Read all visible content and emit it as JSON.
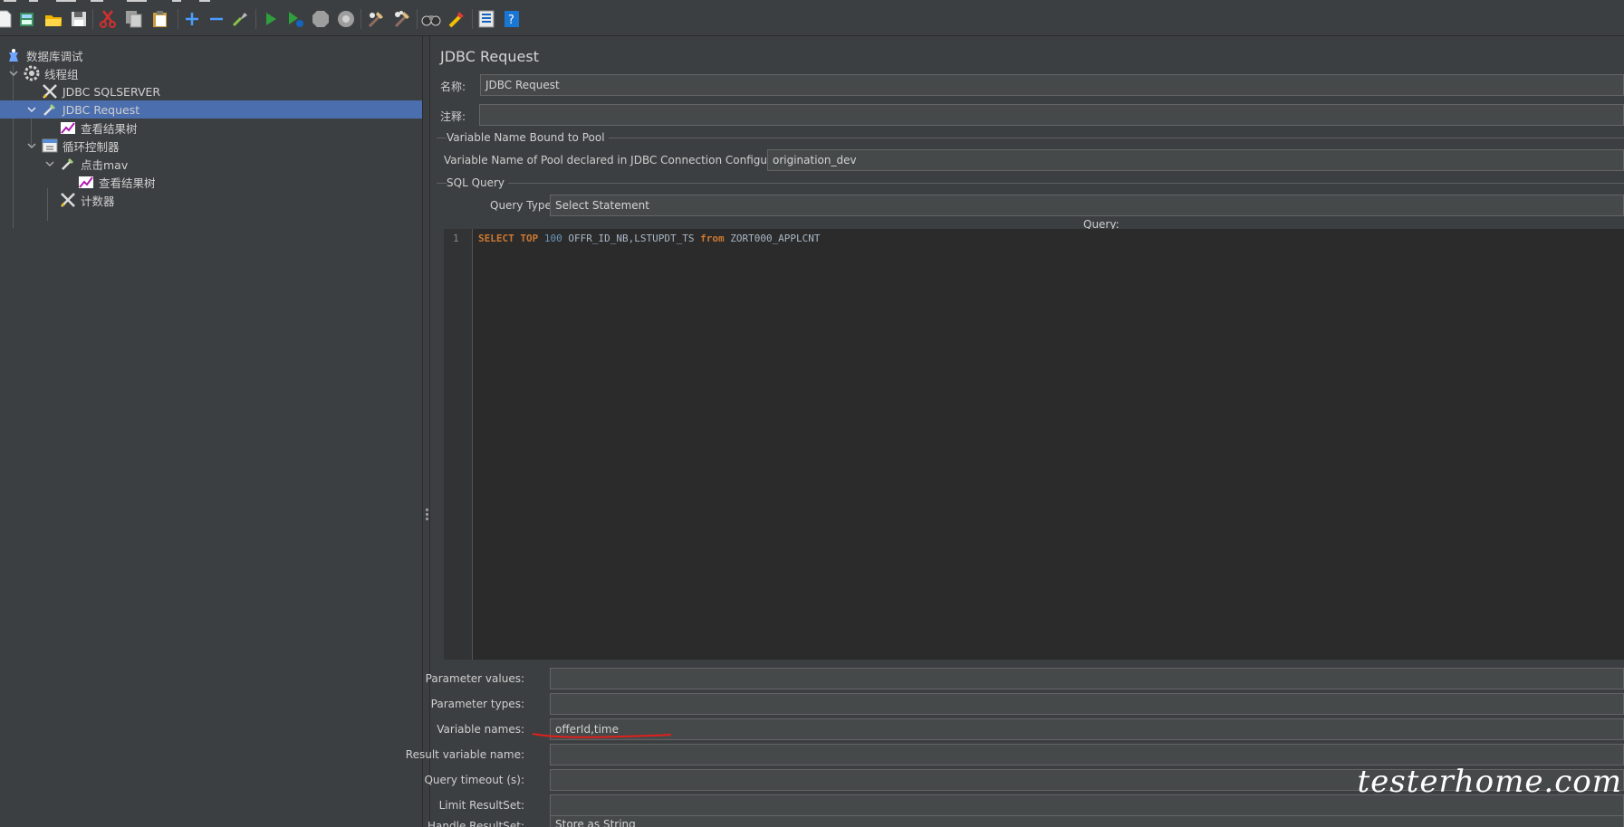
{
  "toolbar": {
    "buttons": [
      "new-icon",
      "templates-icon",
      "open-icon",
      "save-icon",
      "cut-icon",
      "copy-icon",
      "paste-icon",
      "expand-icon",
      "collapse-icon",
      "toggle-icon",
      "start-icon",
      "start-no-pause-icon",
      "stop-icon",
      "shutdown-icon",
      "clear-icon",
      "clear-all-icon",
      "search-icon",
      "reset-search-icon",
      "function-helper-icon",
      "help-icon"
    ]
  },
  "tree": {
    "items": [
      {
        "label": "数据库调试"
      },
      {
        "label": "线程组"
      },
      {
        "label": "JDBC SQLSERVER"
      },
      {
        "label": "JDBC Request"
      },
      {
        "label": "查看结果树"
      },
      {
        "label": "循环控制器"
      },
      {
        "label": "点击mav"
      },
      {
        "label": "查看结果树"
      },
      {
        "label": "计数器"
      }
    ],
    "selected_index": 3
  },
  "panel": {
    "title": "JDBC Request",
    "name_label": "名称:",
    "name_value": "JDBC Request",
    "comment_label": "注释:",
    "comment_value": "",
    "pool_group_title": "Variable Name Bound to Pool",
    "pool_label": "Variable Name of Pool declared in JDBC Connection Configuration:",
    "pool_value": "origination_dev",
    "sql_group_title": "SQL Query",
    "query_type_label": "Query Type:",
    "query_type_value": "Select Statement",
    "query_label": "Query:",
    "line_number": "1",
    "sql": {
      "kw1": "SELECT",
      "kw2": "TOP",
      "num": "100",
      "cols": "OFFR_ID_NB,LSTUPDT_TS",
      "kw3": "from",
      "table": "ZORT000_APPLCNT"
    },
    "fields": [
      {
        "label": "Parameter values:",
        "value": ""
      },
      {
        "label": "Parameter types:",
        "value": ""
      },
      {
        "label": "Variable names:",
        "value": "offerId,time"
      },
      {
        "label": "Result variable name:",
        "value": ""
      },
      {
        "label": "Query timeout (s):",
        "value": ""
      },
      {
        "label": "Limit ResultSet:",
        "value": ""
      },
      {
        "label": "Handle ResultSet:",
        "value": "Store as String"
      }
    ]
  },
  "watermark": "testerhome.com",
  "colors": {
    "background": "#3c3f41",
    "selection": "#4b6eaf",
    "editor": "#2b2b2b",
    "keyword": "#cc7832",
    "number": "#6897bb",
    "annotation": "#e0201b"
  }
}
